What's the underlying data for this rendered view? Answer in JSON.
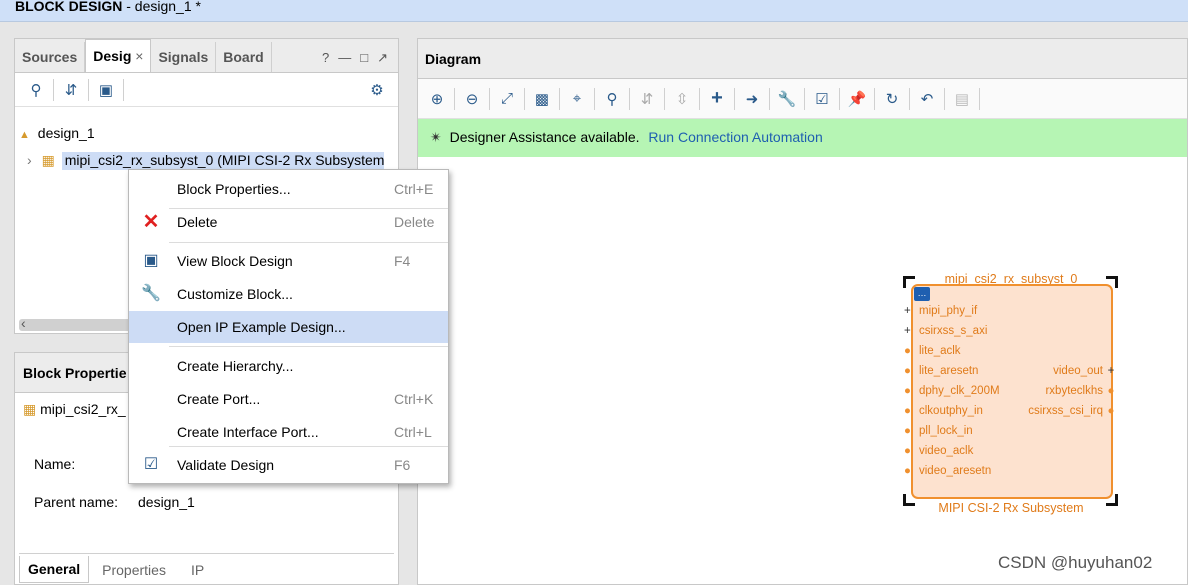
{
  "window": {
    "title": "BLOCK DESIGN",
    "title_suffix": " - design_1 *"
  },
  "left": {
    "tabs": [
      "Sources",
      "Desig",
      "Signals",
      "Board"
    ],
    "tab_close": "×",
    "tab_help": "?",
    "tree": {
      "root": "design_1",
      "child": "mipi_csi2_rx_subsyst_0 (MIPI CSI-2 Rx Subsystem"
    }
  },
  "props": {
    "title": "Block Propertie",
    "item": "mipi_csi2_rx_",
    "name_label": "Name:",
    "parent_label": "Parent name:",
    "parent_value": "design_1",
    "tabs": [
      "General",
      "Properties",
      "IP"
    ]
  },
  "diagram": {
    "title": "Diagram",
    "assist_text": "Designer Assistance available.",
    "assist_link": "Run Connection Automation",
    "block": {
      "instance": "mipi_csi2_rx_subsyst_0",
      "caption": "MIPI CSI-2 Rx Subsystem",
      "left_ports": [
        "mipi_phy_if",
        "csirxss_s_axi",
        "lite_aclk",
        "lite_aresetn",
        "dphy_clk_200M",
        "clkoutphy_in",
        "pll_lock_in",
        "video_aclk",
        "video_aresetn"
      ],
      "right_ports": [
        "video_out",
        "rxbyteclkhs",
        "csirxss_csi_irq"
      ]
    }
  },
  "menu": {
    "items": [
      {
        "label": "Block Properties...",
        "shortcut": "Ctrl+E"
      },
      {
        "label": "Delete",
        "shortcut": "Delete"
      },
      {
        "label": "View Block Design",
        "shortcut": "F4"
      },
      {
        "label": "Customize Block...",
        "shortcut": ""
      },
      {
        "label": "Open IP Example Design...",
        "shortcut": ""
      },
      {
        "label": "Create Hierarchy...",
        "shortcut": ""
      },
      {
        "label": "Create Port...",
        "shortcut": "Ctrl+K"
      },
      {
        "label": "Create Interface Port...",
        "shortcut": "Ctrl+L"
      },
      {
        "label": "Validate Design",
        "shortcut": "F6"
      }
    ]
  },
  "watermark": "CSDN @huyuhan02",
  "colors": {
    "accent": "#1f5fb0",
    "assist_bg": "#b6f5b4",
    "block_fill": "#fde2cf",
    "block_stroke": "#f0902e",
    "menu_highlight": "#cddcf5"
  }
}
